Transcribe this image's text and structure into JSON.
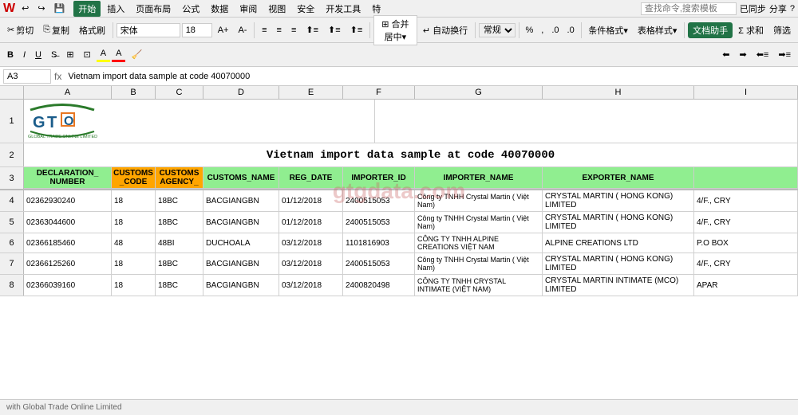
{
  "app": {
    "title": "WPS Office - Spreadsheet",
    "formula_ref": "A3",
    "formula_content": "Vietnam import data sample at code 40070000"
  },
  "menu": {
    "items": [
      "开始",
      "插入",
      "页面布局",
      "公式",
      "数据",
      "审阅",
      "视图",
      "安全",
      "开发工具",
      "特"
    ],
    "search_placeholder": "查找命令,搜索模板",
    "right_items": [
      "已同步",
      "分享",
      "?"
    ]
  },
  "toolbar": {
    "clipboard": [
      "剪切",
      "复制",
      "格式刷"
    ],
    "font_name": "宋体",
    "font_size": "18",
    "bold": "B",
    "italic": "I",
    "underline": "U"
  },
  "title": "Vietnam import data sample at code 40070000",
  "columns": {
    "letters": [
      "A",
      "B",
      "C",
      "D",
      "E",
      "F",
      "G",
      "H"
    ],
    "widths": [
      110,
      55,
      60,
      95,
      80,
      90,
      160,
      190
    ]
  },
  "header_row": {
    "cells": [
      {
        "label": "DECLARATION_\nNUMBER",
        "type": "green"
      },
      {
        "label": "CUSTOMS\n_CODE",
        "type": "orange"
      },
      {
        "label": "CUSTOMS\nAGENCY_",
        "type": "orange"
      },
      {
        "label": "CUSTOMS_NAME",
        "type": "green"
      },
      {
        "label": "REG_DATE",
        "type": "green"
      },
      {
        "label": "IMPORTER_ID",
        "type": "green"
      },
      {
        "label": "IMPORTER_NAME",
        "type": "green"
      },
      {
        "label": "EXPORTER_NAME",
        "type": "green"
      }
    ]
  },
  "data_rows": [
    {
      "cells": [
        "02362930240",
        "18",
        "18BC",
        "BACGIANGBN",
        "01/12/2018",
        "2400515053",
        "Công ty TNHH Crystal Martin ( Việt Nam)",
        "CRYSTAL MARTIN ( HONG KONG) LIMITED"
      ],
      "extra": "4/F., CRY"
    },
    {
      "cells": [
        "02363044600",
        "18",
        "18BC",
        "BACGIANGBN",
        "01/12/2018",
        "2400515053",
        "Công ty TNHH Crystal Martin ( Việt Nam)",
        "CRYSTAL MARTIN ( HONG KONG) LIMITED"
      ],
      "extra": "4/F., CRY"
    },
    {
      "cells": [
        "02366185460",
        "48",
        "48BI",
        "DUCHOALA",
        "03/12/2018",
        "1101816903",
        "CÔNG TY TNHH ALPINE CREATIONS VIỆT NAM",
        "ALPINE CREATIONS  LTD"
      ],
      "extra": "P.O BOX"
    },
    {
      "cells": [
        "02366125260",
        "18",
        "18BC",
        "BACGIANGBN",
        "03/12/2018",
        "2400515053",
        "Công ty TNHH Crystal Martin ( Việt Nam)",
        "CRYSTAL MARTIN ( HONG KONG) LIMITED"
      ],
      "extra": "4/F., CRY"
    },
    {
      "cells": [
        "02366039160",
        "18",
        "18BC",
        "BACGIANGBN",
        "03/12/2018",
        "2400820498",
        "CÔNG TY TNHH CRYSTAL INTIMATE (VIỆT NAM)",
        "CRYSTAL MARTIN INTIMATE (MCO) LIMITED"
      ],
      "extra": "APAR"
    }
  ],
  "bottom_bar": {
    "text": "with Global Trade Online Limited"
  },
  "watermark": {
    "text": "gtgdata.com"
  }
}
